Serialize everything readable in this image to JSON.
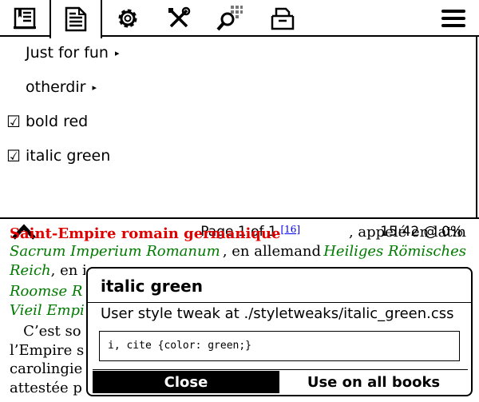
{
  "toolbar": {
    "tabs": [
      "navigation-icon",
      "document-icon",
      "settings-icon",
      "tools-icon",
      "search-icon",
      "filemanager-icon"
    ],
    "menu": "hamburger-icon"
  },
  "menu": {
    "submenus": [
      {
        "label": "Just for fun",
        "arrow": "▸"
      },
      {
        "label": "otherdir",
        "arrow": "▸"
      }
    ],
    "checks": [
      {
        "box": "☑",
        "label": "bold red",
        "checked": true
      },
      {
        "box": "☑",
        "label": "italic green",
        "checked": true
      }
    ]
  },
  "footer": {
    "page": "Page 1 of 1",
    "time": "15:42 @ 0%"
  },
  "book": {
    "line1_red": "Saint-Empire romain germanique",
    "line1_ref": "[16]",
    "line1_rest": ", appelé en latin",
    "line2_green": "Sacrum Imperium Romanum",
    "line2_mid": ", en allemand ",
    "line2_green2": "Heiliges Römisches",
    "line3_green": "Reich",
    "line3_rest": ", en i",
    "line4_green": "Roomse R",
    "line5_green": "Vieil Empi",
    "line6": "   C’est so",
    "line7": "l’Empire s",
    "line8": "carolingie",
    "line9": "attestée p"
  },
  "dialog": {
    "title": "italic green",
    "desc": "User style tweak at ./styletweaks/italic_green.css",
    "code": "i, cite {color: green;}",
    "close": "Close",
    "use_all": "Use on all books"
  }
}
